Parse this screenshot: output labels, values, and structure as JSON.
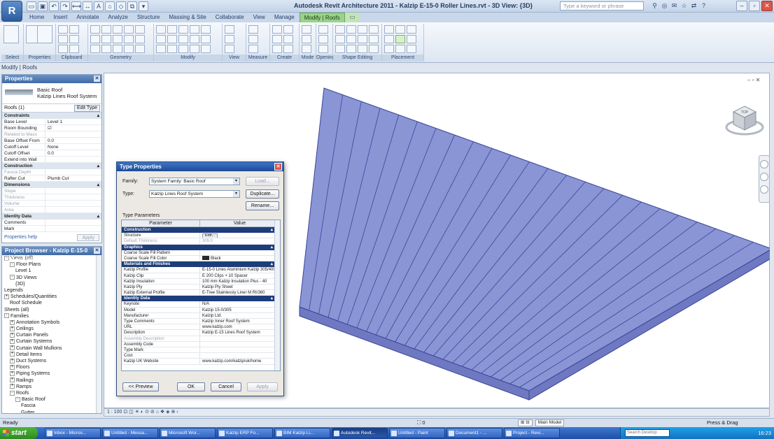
{
  "titlebar": {
    "app_button": "R",
    "window_title": "Autodesk Revit Architecture 2011 - Kalzip E-15-0 Roller Lines.rvt - 3D View: {3D}",
    "help_search_placeholder": "Type a keyword or phrase"
  },
  "ribbon": {
    "tabs": [
      "Home",
      "Insert",
      "Annotate",
      "Analyze",
      "Structure",
      "Massing & Site",
      "Collaborate",
      "View",
      "Manage",
      "Modify | Roofs",
      "▭"
    ],
    "active_tab_index": 9,
    "groups": [
      "Select",
      "Properties",
      "Clipboard",
      "Geometry",
      "Modify",
      "View",
      "Measure",
      "Create",
      "Mode",
      "Opening",
      "Shape Editing",
      "Placement"
    ]
  },
  "modify_label": "Modify | Roofs",
  "properties": {
    "title": "Properties",
    "type_family": "Basic Roof",
    "type_name": "Kalzip Lines Roof System",
    "instance_label": "Roofs (1)",
    "edit_type": "Edit Type",
    "groups": [
      {
        "name": "Constraints",
        "rows": [
          {
            "name": "Base Level",
            "value": "Level 1",
            "dim": false
          },
          {
            "name": "Room Bounding",
            "value": "☑",
            "dim": false
          },
          {
            "name": "Related to Mass",
            "value": "",
            "dim": true
          },
          {
            "name": "Base Offset From",
            "value": "0.0",
            "dim": false
          },
          {
            "name": "Cutoff Level",
            "value": "None",
            "dim": false
          },
          {
            "name": "Cutoff Offset",
            "value": "0.0",
            "dim": false
          },
          {
            "name": "Extend into Wall",
            "value": "",
            "dim": false
          }
        ]
      },
      {
        "name": "Construction",
        "rows": [
          {
            "name": "Fascia Depth",
            "value": "",
            "dim": true
          },
          {
            "name": "Rafter Cut",
            "value": "Plumb Cut",
            "dim": false
          }
        ]
      },
      {
        "name": "Dimensions",
        "rows": [
          {
            "name": "Slope",
            "value": "",
            "dim": true
          },
          {
            "name": "Thickness",
            "value": "",
            "dim": true
          },
          {
            "name": "Volume",
            "value": "",
            "dim": true
          },
          {
            "name": "Area",
            "value": "",
            "dim": true
          }
        ]
      },
      {
        "name": "Identity Data",
        "rows": [
          {
            "name": "Comments",
            "value": "",
            "dim": false
          },
          {
            "name": "Mark",
            "value": "",
            "dim": false
          }
        ]
      }
    ],
    "help_link": "Properties help",
    "apply": "Apply"
  },
  "browser": {
    "title": "Project Browser - Kalzip E-15-0 Roller Lines.rvt",
    "rows": [
      {
        "indent": 0,
        "exp": "-",
        "label": "Views (all)"
      },
      {
        "indent": 1,
        "exp": "-",
        "label": "Floor Plans"
      },
      {
        "indent": 2,
        "exp": "",
        "label": "Level 1"
      },
      {
        "indent": 1,
        "exp": "-",
        "label": "3D Views"
      },
      {
        "indent": 2,
        "exp": "",
        "label": "{3D}"
      },
      {
        "indent": 0,
        "exp": "",
        "label": "Legends"
      },
      {
        "indent": 0,
        "exp": "+",
        "label": "Schedules/Quantities"
      },
      {
        "indent": 1,
        "exp": "",
        "label": "Roof Schedule"
      },
      {
        "indent": 0,
        "exp": "",
        "label": "Sheets (all)"
      },
      {
        "indent": 0,
        "exp": "-",
        "label": "Families"
      },
      {
        "indent": 1,
        "exp": "+",
        "label": "Annotation Symbols"
      },
      {
        "indent": 1,
        "exp": "+",
        "label": "Ceilings"
      },
      {
        "indent": 1,
        "exp": "+",
        "label": "Curtain Panels"
      },
      {
        "indent": 1,
        "exp": "+",
        "label": "Curtain Systems"
      },
      {
        "indent": 1,
        "exp": "+",
        "label": "Curtain Wall Mullions"
      },
      {
        "indent": 1,
        "exp": "+",
        "label": "Detail Items"
      },
      {
        "indent": 1,
        "exp": "+",
        "label": "Duct Systems"
      },
      {
        "indent": 1,
        "exp": "+",
        "label": "Floors"
      },
      {
        "indent": 1,
        "exp": "+",
        "label": "Piping Systems"
      },
      {
        "indent": 1,
        "exp": "+",
        "label": "Railings"
      },
      {
        "indent": 1,
        "exp": "+",
        "label": "Ramps"
      },
      {
        "indent": 1,
        "exp": "-",
        "label": "Roofs"
      },
      {
        "indent": 2,
        "exp": "-",
        "label": "Basic Roof"
      },
      {
        "indent": 3,
        "exp": "",
        "label": "Fascia"
      },
      {
        "indent": 3,
        "exp": "",
        "label": "Gutter"
      }
    ]
  },
  "dialog": {
    "title": "Type Properties",
    "family_label": "Family:",
    "family_value": "System Family: Basic Roof",
    "type_label": "Type:",
    "type_value": "Kalzip Lines Roof System",
    "load_button": "Load...",
    "duplicate_button": "Duplicate...",
    "rename_button": "Rename...",
    "type_parameters_label": "Type Parameters",
    "col_parameter": "Parameter",
    "col_value": "Value",
    "groups": [
      {
        "name": "Construction",
        "rows": [
          {
            "name": "Structure",
            "value": "Edit...",
            "kind": "button",
            "dim": false
          },
          {
            "name": "Default Thickness",
            "value": "305.0",
            "kind": "text",
            "dim": true
          }
        ]
      },
      {
        "name": "Graphics",
        "rows": [
          {
            "name": "Coarse Scale Fill Pattern",
            "value": "",
            "kind": "text",
            "dim": false
          },
          {
            "name": "Coarse Scale Fill Color",
            "value": "Black",
            "kind": "swatch",
            "dim": false
          }
        ]
      },
      {
        "name": "Materials and Finishes",
        "rows": [
          {
            "name": "Kalzip Profile",
            "value": "E-15-0 Lines Aluminium Kalzip 305/400",
            "kind": "text",
            "dim": false
          },
          {
            "name": "Kalzip Clip",
            "value": "E 200 Clips + 10 Spacer",
            "kind": "text",
            "dim": false
          },
          {
            "name": "Kalzip Insulation",
            "value": "100 mm Kalzip Insulation Plus - 40",
            "kind": "text",
            "dim": false
          },
          {
            "name": "Kalzip Ply",
            "value": "Kalzip Ply Sheet",
            "kind": "text",
            "dim": false
          },
          {
            "name": "Kalzip External Profile",
            "value": "E-Tree Stainlessly Liner M Rt/360",
            "kind": "text",
            "dim": false
          }
        ]
      },
      {
        "name": "Identity Data",
        "rows": [
          {
            "name": "Keynote",
            "value": "N/A",
            "kind": "text",
            "dim": false
          },
          {
            "name": "Model",
            "value": "Kalzip 15-0/305",
            "kind": "text",
            "dim": false
          },
          {
            "name": "Manufacturer",
            "value": "Kalzip Ltd.",
            "kind": "text",
            "dim": false
          },
          {
            "name": "Type Comments",
            "value": "Kalzip Inner Roof System",
            "kind": "text",
            "dim": false
          },
          {
            "name": "URL",
            "value": "www.kalzip.com",
            "kind": "text",
            "dim": false
          },
          {
            "name": "Description",
            "value": "Kalzip E-15 Lines Roof System",
            "kind": "text",
            "dim": false
          },
          {
            "name": "Assembly Description",
            "value": "",
            "kind": "text",
            "dim": true
          },
          {
            "name": "Assembly Code",
            "value": "",
            "kind": "text",
            "dim": false
          },
          {
            "name": "Type Mark",
            "value": "",
            "kind": "text",
            "dim": false
          },
          {
            "name": "Cost",
            "value": "",
            "kind": "text",
            "dim": false
          },
          {
            "name": "Kalzip UK Website",
            "value": "www.kalzip.com/kalzip/uk/home",
            "kind": "text",
            "dim": false
          }
        ]
      }
    ],
    "preview_button": "<< Preview",
    "ok_button": "OK",
    "cancel_button": "Cancel",
    "apply_button": "Apply"
  },
  "drawing": {
    "view_controls": "– ▫ ✕",
    "viewcube_label": "TOP",
    "roof_color": "#8a95d6",
    "roof_side_color": "#6e79c2",
    "roof_edge_color": "#3a4596"
  },
  "viewbar": {
    "text": "1 : 100   ⊡ ◫ ☀ ◐ ⊙ ⊘ ⌂ ❖ ◈ ⊕ ‹"
  },
  "statusbar": {
    "text": "Ready",
    "mid": "⛶ 0",
    "main_model": "Main Model",
    "press_drag": "Press & Drag"
  },
  "taskbar": {
    "start": "start",
    "tasks": [
      {
        "label": "Inbox - Micros...",
        "active": false
      },
      {
        "label": "Untitled - Messa...",
        "active": false
      },
      {
        "label": "Microsoft Wor...",
        "active": false
      },
      {
        "label": "Kalzip ERP Fo...",
        "active": false
      },
      {
        "label": "BIM Kalzip Li...",
        "active": false
      },
      {
        "label": "Autodesk Revit...",
        "active": true
      },
      {
        "label": "Untitled - Paint",
        "active": false
      },
      {
        "label": "Document1 - ...",
        "active": false
      },
      {
        "label": "Project - Revi...",
        "active": false
      }
    ],
    "search_placeholder": "Search Desktop",
    "clock": "16:23"
  }
}
